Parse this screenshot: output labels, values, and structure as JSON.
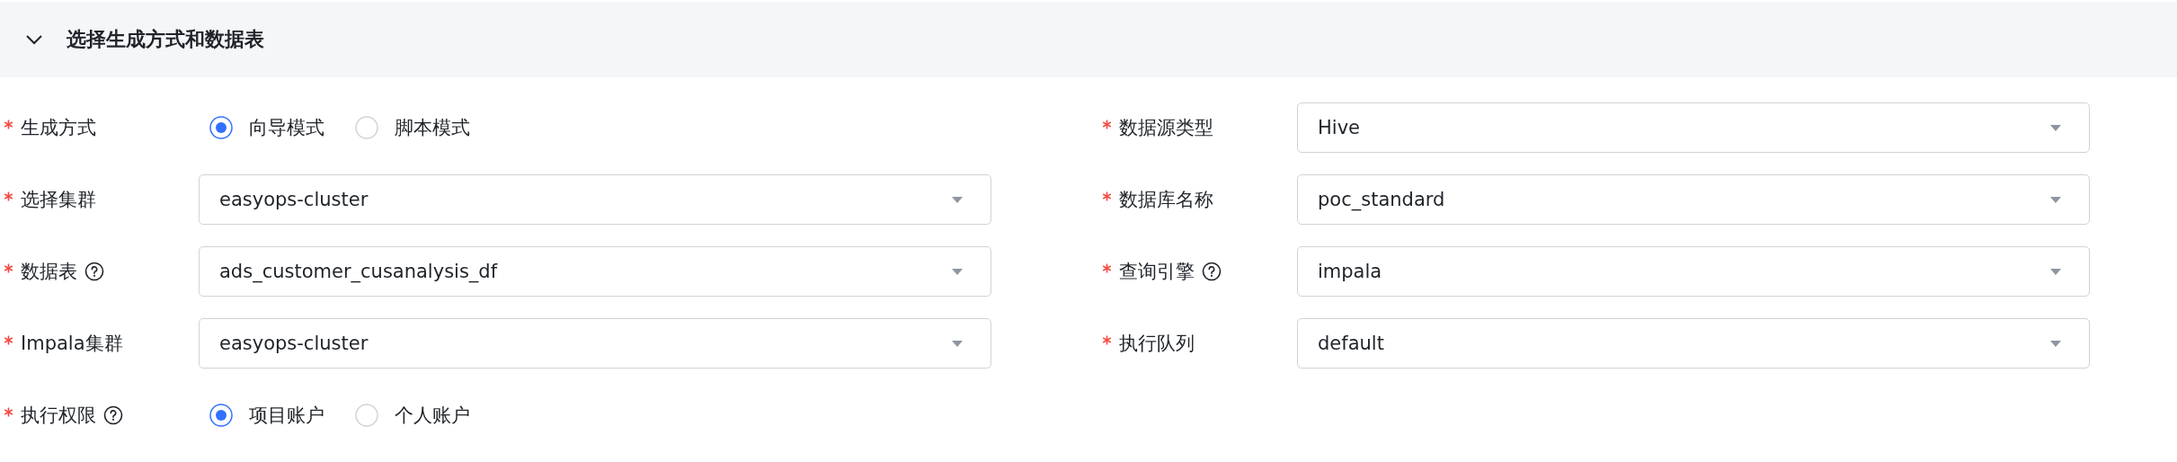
{
  "section": {
    "title": "选择生成方式和数据表",
    "expanded": true
  },
  "fields": [
    {
      "kind": "radio",
      "label": "生成方式",
      "required": true,
      "help": false,
      "options": [
        {
          "label": "向导模式",
          "selected": true
        },
        {
          "label": "脚本模式",
          "selected": false
        }
      ]
    },
    {
      "kind": "select",
      "label": "数据源类型",
      "required": true,
      "help": false,
      "value": "Hive"
    },
    {
      "kind": "select",
      "label": "选择集群",
      "required": true,
      "help": false,
      "value": "easyops-cluster"
    },
    {
      "kind": "select",
      "label": "数据库名称",
      "required": true,
      "help": false,
      "value": "poc_standard"
    },
    {
      "kind": "select",
      "label": "数据表",
      "required": true,
      "help": true,
      "value": "ads_customer_cusanalysis_df"
    },
    {
      "kind": "select",
      "label": "查询引擎",
      "required": true,
      "help": true,
      "value": "impala"
    },
    {
      "kind": "select",
      "label": "Impala集群",
      "required": true,
      "help": false,
      "value": "easyops-cluster"
    },
    {
      "kind": "select",
      "label": "执行队列",
      "required": true,
      "help": false,
      "value": "default"
    },
    {
      "kind": "radio",
      "label": "执行权限",
      "required": true,
      "help": true,
      "options": [
        {
          "label": "项目账户",
          "selected": true
        },
        {
          "label": "个人账户",
          "selected": false
        }
      ]
    }
  ]
}
